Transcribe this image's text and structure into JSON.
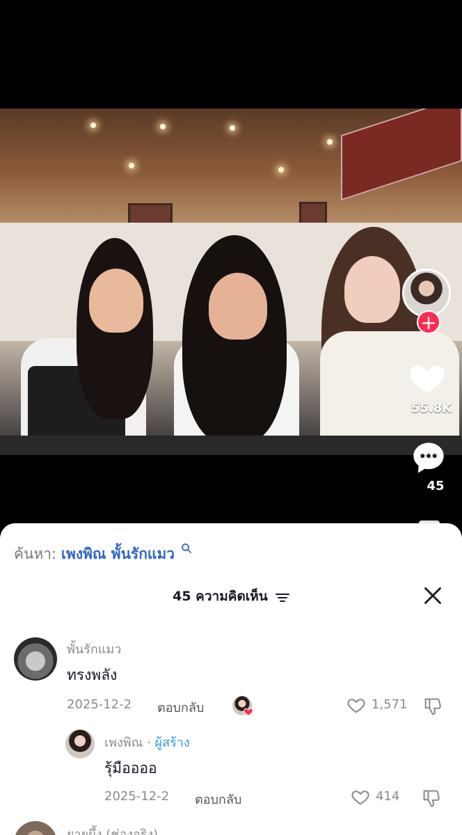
{
  "video": {
    "like_count": "55.8K",
    "comment_count": "45"
  },
  "sheet": {
    "search_prefix": "ค้นหา:",
    "search_term": "เพงพิณ พั้นรักแมว",
    "title": "45 ความคิดเห็น",
    "comments": [
      {
        "username": "พั้นรักแมว",
        "text": "ทรงพลัง",
        "date": "2025-12-2",
        "reply_label": "ตอบกลับ",
        "likes": "1,571"
      },
      {
        "username": "เพงพิณ",
        "separator": " · ",
        "creator_tag": "ผู้สร้าง",
        "text": "รุ้มืออออ",
        "date": "2025-12-2",
        "reply_label": "ตอบกลับ",
        "likes": "414"
      },
      {
        "username": "ยายผึ้ง (ช่องจริง)"
      }
    ]
  },
  "colors": {
    "accent_red": "#fe2c55",
    "search_blue": "#2f66c7",
    "creator_blue": "#2f9ad6"
  }
}
